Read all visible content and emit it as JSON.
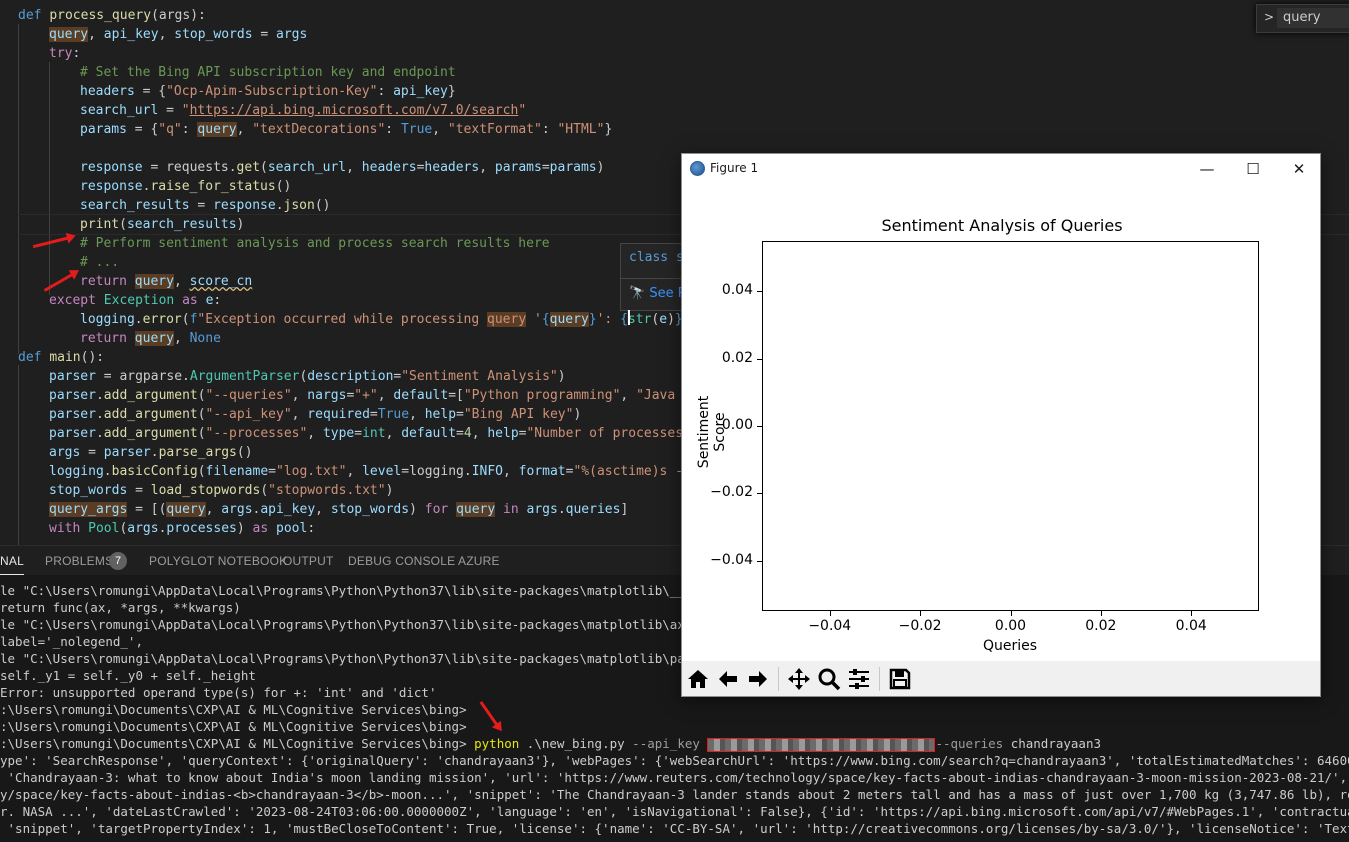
{
  "editor": {
    "search_query": "query",
    "hover_signature": "class s",
    "hover_link": "See R",
    "lines": {
      "l1_def": "def",
      "l1_fn": "process_query",
      "l1_args": "(args):",
      "l2_query": "query",
      "l2_rest": ", ",
      "l2_apikey": "api_key",
      "l2_comma": ", ",
      "l2_stop": "stop_words",
      "l2_eq": " = ",
      "l2_args": "args",
      "l3_try": "try",
      "l3_colon": ":",
      "l4": "# Set the Bing API subscription key and endpoint",
      "l5_headers": "headers",
      "l5_eq": " = {",
      "l5_str": "\"Ocp-Apim-Subscription-Key\"",
      "l5_colon": ": ",
      "l5_var": "api_key",
      "l5_end": "}",
      "l6_var": "search_url",
      "l6_eq": " = ",
      "l6_q1": "\"",
      "l6_url": "https://api.bing.microsoft.com/v7.0/search",
      "l6_q2": "\"",
      "l7_var": "params",
      "l7_eq": " = {",
      "l7_s1": "\"q\"",
      "l7_c1": ": ",
      "l7_query": "query",
      "l7_c2": ", ",
      "l7_s2": "\"textDecorations\"",
      "l7_c3": ": ",
      "l7_true": "True",
      "l7_c4": ", ",
      "l7_s3": "\"textFormat\"",
      "l7_c5": ": ",
      "l7_s4": "\"HTML\"",
      "l7_end": "}",
      "l9_var": "response",
      "l9_eq": " = requests.",
      "l9_fn": "get",
      "l9_p1": "(",
      "l9_a1": "search_url",
      "l9_c1": ", ",
      "l9_a2": "headers",
      "l9_e1": "=",
      "l9_a3": "headers",
      "l9_c2": ", ",
      "l9_a4": "params",
      "l9_e2": "=",
      "l9_a5": "params",
      "l9_p2": ")",
      "l10_var": "response",
      "l10_dot": ".",
      "l10_fn": "raise_for_status",
      "l10_p": "()",
      "l11_var": "search_results",
      "l11_eq": " = ",
      "l11_var2": "response",
      "l11_dot": ".",
      "l11_fn": "json",
      "l11_p": "()",
      "l12_fn": "print",
      "l12_p1": "(",
      "l12_var": "search_results",
      "l12_p2": ")",
      "l13": "# Perform sentiment analysis and process search results here",
      "l14": "# ...",
      "l15_ret": "return",
      "l15_sp": " ",
      "l15_query": "query",
      "l15_c": ", ",
      "l15_score": "score_cn",
      "l16_exc": "except",
      "l16_sp": " ",
      "l16_cls": "Exception",
      "l16_as": " as ",
      "l16_e": "e",
      "l16_colon": ":",
      "l17_log": "logging",
      "l17_dot": ".",
      "l17_fn": "error",
      "l17_p": "(",
      "l17_f": "f",
      "l17_s1": "\"Exception occurred while processing ",
      "l17_q": "query",
      "l17_s2": " '",
      "l17_b1": "{",
      "l17_q2": "query",
      "l17_b2": "}",
      "l17_s3": "': ",
      "l17_b3": "{",
      "l17_str": "str",
      "l17_p3": "(",
      "l17_e": "e",
      "l17_p4": ")",
      "l17_b4": "}",
      "l17_s4": "\"",
      "l18_ret": "return",
      "l18_sp": " ",
      "l18_query": "query",
      "l18_c": ", ",
      "l18_none": "None",
      "l19_def": "def",
      "l19_sp": " ",
      "l19_fn": "main",
      "l19_p": "():",
      "l20_var": "parser",
      "l20_eq": " = argparse.",
      "l20_cls": "ArgumentParser",
      "l20_p": "(",
      "l20_a": "description",
      "l20_e": "=",
      "l20_s": "\"Sentiment Analysis\"",
      "l20_end": ")",
      "l21_var": "parser",
      "l21_dot": ".",
      "l21_fn": "add_argument",
      "l21_p": "(",
      "l21_s1": "\"--queries\"",
      "l21_c1": ", ",
      "l21_a1": "nargs",
      "l21_e1": "=",
      "l21_s2": "\"+\"",
      "l21_c2": ", ",
      "l21_a2": "default",
      "l21_e2": "=[",
      "l21_s3": "\"Python programming\"",
      "l21_c3": ", ",
      "l21_s4": "\"Java p",
      "l22_var": "parser",
      "l22_dot": ".",
      "l22_fn": "add_argument",
      "l22_p": "(",
      "l22_s1": "\"--api_key\"",
      "l22_c1": ", ",
      "l22_a1": "required",
      "l22_e1": "=",
      "l22_true": "True",
      "l22_c2": ", ",
      "l22_a2": "help",
      "l22_e2": "=",
      "l22_s2": "\"Bing API key\"",
      "l22_end": ")",
      "l23_var": "parser",
      "l23_dot": ".",
      "l23_fn": "add_argument",
      "l23_p": "(",
      "l23_s1": "\"--processes\"",
      "l23_c1": ", ",
      "l23_a1": "type",
      "l23_e1": "=",
      "l23_int": "int",
      "l23_c2": ", ",
      "l23_a2": "default",
      "l23_e2": "=",
      "l23_num": "4",
      "l23_c3": ", ",
      "l23_a3": "help",
      "l23_e3": "=",
      "l23_s2": "\"Number of processes",
      "l24_var": "args",
      "l24_eq": " = ",
      "l24_var2": "parser",
      "l24_dot": ".",
      "l24_fn": "parse_args",
      "l24_p": "()",
      "l25_log": "logging",
      "l25_dot": ".",
      "l25_fn": "basicConfig",
      "l25_p": "(",
      "l25_a1": "filename",
      "l25_e1": "=",
      "l25_s1": "\"log.txt\"",
      "l25_c1": ", ",
      "l25_a2": "level",
      "l25_e2": "=logging.",
      "l25_lv": "INFO",
      "l25_c2": ", ",
      "l25_a3": "format",
      "l25_e3": "=",
      "l25_s2": "\"%(asctime)s - ",
      "l26_var": "stop_words",
      "l26_eq": " = ",
      "l26_fn": "load_stopwords",
      "l26_p": "(",
      "l26_s": "\"stopwords.txt\"",
      "l26_end": ")",
      "l27_var": "query_args",
      "l27_eq": " = [(",
      "l27_q": "query",
      "l27_c1": ", ",
      "l27_a": "args",
      "l27_dot": ".",
      "l27_key": "api_key",
      "l27_c2": ", ",
      "l27_stop": "stop_words",
      "l27_p": ") ",
      "l27_for": "for",
      "l27_sp": " ",
      "l27_q2": "query",
      "l27_in": " in ",
      "l27_args": "args",
      "l27_dot2": ".",
      "l27_queries": "queries",
      "l27_end": "]",
      "l28_with": "with",
      "l28_sp": " ",
      "l28_cls": "Pool",
      "l28_p": "(",
      "l28_args": "args",
      "l28_dot": ".",
      "l28_proc": "processes",
      "l28_p2": ") ",
      "l28_as": "as",
      "l28_sp2": " ",
      "l28_pool": "pool",
      "l28_colon": ":"
    }
  },
  "panel": {
    "tabs": [
      "NAL",
      "PROBLEMS",
      "POLYGLOT NOTEBOOK",
      "OUTPUT",
      "DEBUG CONSOLE",
      "AZURE"
    ],
    "problems_count": "7"
  },
  "terminal": {
    "lines": [
      "le \"C:\\Users\\romungi\\AppData\\Local\\Programs\\Python\\Python37\\lib\\site-packages\\matplotlib\\__init__.",
      "return func(ax, *args, **kwargs)",
      "le \"C:\\Users\\romungi\\AppData\\Local\\Programs\\Python\\Python37\\lib\\site-packages\\matplotlib\\axes\\_axe",
      "label='_nolegend_',",
      "le \"C:\\Users\\romungi\\AppData\\Local\\Programs\\Python\\Python37\\lib\\site-packages\\matplotlib\\patches.p",
      "self._y1 = self._y0 + self._height",
      "Error: unsupported operand type(s) for +: 'int' and 'dict'",
      ":\\Users\\romungi\\Documents\\CXP\\AI & ML\\Cognitive Services\\bing>",
      ":\\Users\\romungi\\Documents\\CXP\\AI & ML\\Cognitive Services\\bing>"
    ],
    "prompt": ":\\Users\\romungi\\Documents\\CXP\\AI & ML\\Cognitive Services\\bing> ",
    "cmd": "python",
    "cmd_script": " .\\new_bing.py ",
    "cmd_flag1": "--api_key ",
    "cmd_flag2": "--queries",
    "cmd_arg2": " chandrayaan3",
    "output": [
      "ype': 'SearchResponse', 'queryContext': {'originalQuery': 'chandrayaan3'}, 'webPages': {'webSearchUrl': 'https://www.bing.com/search?q=chandrayaan3', 'totalEstimatedMatches': 6460000, 'value':",
      " 'Chandrayaan-3: what to know about India's moon landing mission', 'url': 'https://www.reuters.com/technology/space/key-facts-about-indias-chandrayaan-3-moon-mission-2023-08-21/', 'isFamilyFrie",
      "y/space/key-facts-about-indias-<b>chandrayaan-3</b>-moon...', 'snippet': 'The Chandrayaan-3 lander stands about 2 meters tall and has a mass of just over 1,700 kg (3,747.86 lb), roughly on par",
      "r. NASA ...', 'dateLastCrawled': '2023-08-24T03:06:00.0000000Z', 'language': 'en', 'isNavigational': False}, {'id': 'https://api.bing.microsoft.com/api/v7/#WebPages.1', 'contractualRules': [{'_",
      " 'snippet', 'targetPropertyIndex': 1, 'mustBeCloseToContent': True, 'license': {'name': 'CC-BY-SA', 'url': 'http://creativecommons.org/licenses/by-sa/3.0/'}, 'licenseNotice': 'Text under CC-BY-S"
    ]
  },
  "figure": {
    "window_title": "Figure 1",
    "minimize": "—",
    "maximize": "☐",
    "close": "✕",
    "toolbar_icons": [
      "home-icon",
      "back-arrow-icon",
      "forward-arrow-icon",
      "pan-icon",
      "zoom-icon",
      "configure-subplots-icon",
      "save-icon"
    ]
  },
  "chart_data": {
    "type": "bar",
    "title": "Sentiment Analysis of Queries",
    "xlabel": "Queries",
    "ylabel": "Sentiment Score",
    "xlim": [
      -0.055,
      0.055
    ],
    "ylim": [
      -0.055,
      0.055
    ],
    "xticks": [
      "−0.04",
      "−0.02",
      "0.00",
      "0.02",
      "0.04"
    ],
    "yticks": [
      "0.04",
      "0.02",
      "0.00",
      "−0.02",
      "−0.04"
    ],
    "xtick_values": [
      -0.04,
      -0.02,
      0.0,
      0.02,
      0.04
    ],
    "ytick_values": [
      0.04,
      0.02,
      0.0,
      -0.02,
      -0.04
    ],
    "categories": [],
    "values": [],
    "grid": false
  }
}
